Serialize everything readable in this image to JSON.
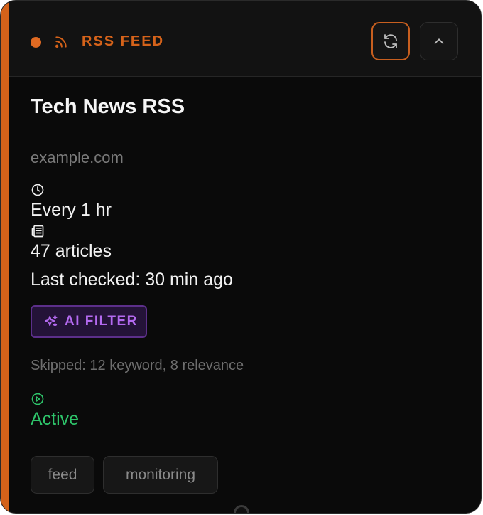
{
  "header": {
    "type_label": "RSS FEED",
    "status_color": "#e06a22",
    "accent_color": "#d4621a",
    "icons": [
      "rss-icon",
      "refresh-icon",
      "chevron-up-icon"
    ]
  },
  "feed": {
    "title": "Tech News RSS",
    "domain": "example.com",
    "interval": "Every 1 hr",
    "articles": "47 articles",
    "last_checked": "Last checked: 30 min ago"
  },
  "ai_filter": {
    "label": "AI FILTER",
    "color": "#b46af0",
    "icon": "sparkles-icon"
  },
  "skipped": "Skipped: 12 keyword, 8 relevance",
  "status": {
    "label": "Active",
    "color": "#2ec46a",
    "icon": "play-circle-icon"
  },
  "tags": [
    "feed",
    "monitoring"
  ]
}
